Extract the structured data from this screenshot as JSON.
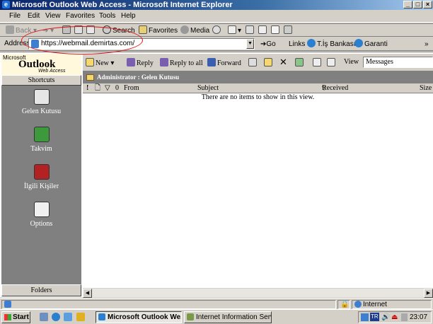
{
  "window": {
    "title": "Microsoft Outlook Web Access - Microsoft Internet Explorer",
    "buttons": {
      "minimize": "_",
      "maximize": "□",
      "close": "×"
    }
  },
  "menu": [
    "File",
    "Edit",
    "View",
    "Favorites",
    "Tools",
    "Help"
  ],
  "toolbar": {
    "back": "Back",
    "search": "Search",
    "favorites": "Favorites",
    "media": "Media"
  },
  "address": {
    "label": "Address",
    "url": "https://webmail.demirtas.com/",
    "go": "Go",
    "links_label": "Links",
    "links": [
      "T.İş Bankası",
      "Garanti"
    ]
  },
  "owa": {
    "logo": {
      "top": "Microsoft",
      "main": "Outlook",
      "sub": "Web Access"
    },
    "shortcuts_header": "Shortcuts",
    "shortcuts": [
      {
        "label": "Gelen Kutusu",
        "icon": "inbox-icon",
        "color": "#e6e6e6"
      },
      {
        "label": "Takvim",
        "icon": "calendar-icon",
        "color": "#3c9a3c"
      },
      {
        "label": "İlgili Kişiler",
        "icon": "contacts-icon",
        "color": "#b22222"
      },
      {
        "label": "Options",
        "icon": "options-icon",
        "color": "#f0f0f0"
      }
    ],
    "folders_header": "Folders",
    "toolbar": {
      "new": "New",
      "reply": "Reply",
      "reply_all": "Reply to all",
      "forward": "Forward",
      "view_label": "View",
      "view_value": "Messages"
    },
    "path": "Administrator : Gelen Kutusu",
    "columns": {
      "from": "From",
      "subject": "Subject",
      "received": "Received",
      "size": "Size"
    },
    "empty_message": "There are no items to show in this view."
  },
  "statusbar": {
    "zone": "Internet"
  },
  "taskbar": {
    "start": "Start",
    "tasks": [
      {
        "label": "Microsoft Outlook We...",
        "active": true
      },
      {
        "label": "Internet Information Serv...",
        "active": false
      }
    ],
    "language": "TR",
    "clock": "23:07"
  },
  "colors": {
    "titlebar": "#0a246a",
    "chrome": "#d4d0c8",
    "sidebar": "#808080",
    "annotation": "#dd1111"
  }
}
